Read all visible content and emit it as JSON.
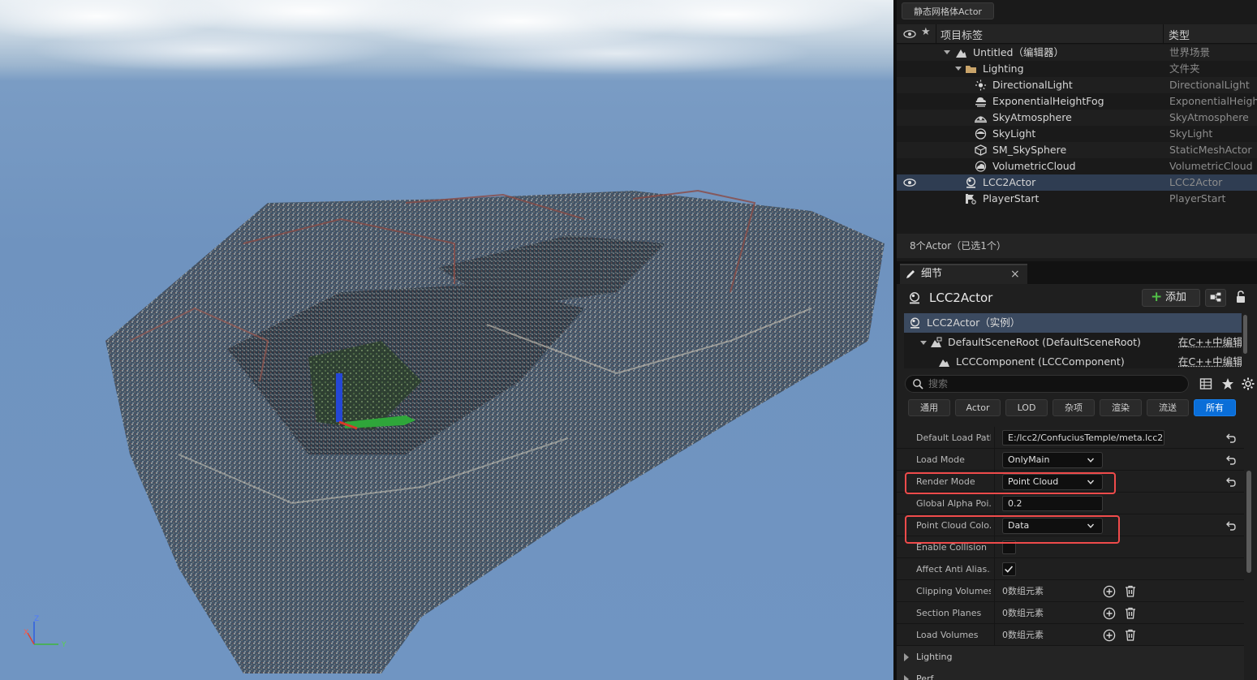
{
  "outliner": {
    "top_chip": "静态网格体Actor",
    "header": {
      "label_col": "项目标签",
      "type_col": "类型"
    },
    "rows": [
      {
        "name": "Untitled（编辑器）",
        "type": "世界场景",
        "icon": "world-icon"
      },
      {
        "name": "Lighting",
        "type": "文件夹",
        "icon": "folder-icon"
      },
      {
        "name": "DirectionalLight",
        "type": "DirectionalLight",
        "icon": "directional-light-icon"
      },
      {
        "name": "ExponentialHeightFog",
        "type": "ExponentialHeightF",
        "icon": "fog-icon"
      },
      {
        "name": "SkyAtmosphere",
        "type": "SkyAtmosphere",
        "icon": "sky-atmosphere-icon"
      },
      {
        "name": "SkyLight",
        "type": "SkyLight",
        "icon": "skylight-icon"
      },
      {
        "name": "SM_SkySphere",
        "type": "StaticMeshActor",
        "icon": "static-mesh-icon"
      },
      {
        "name": "VolumetricCloud",
        "type": "VolumetricCloud",
        "icon": "cloud-icon"
      },
      {
        "name": "LCC2Actor",
        "type": "LCC2Actor",
        "icon": "actor-icon",
        "selected": true
      },
      {
        "name": "PlayerStart",
        "type": "PlayerStart",
        "icon": "player-start-icon"
      }
    ],
    "status": "8个Actor（已选1个）"
  },
  "details": {
    "tab_label": "细节",
    "actor_name": "LCC2Actor",
    "add_label": "添加",
    "components": [
      {
        "name": "LCC2Actor（实例）"
      },
      {
        "name": "DefaultSceneRoot (DefaultSceneRoot)",
        "edit": "在C++中编辑"
      },
      {
        "name": "LCCComponent (LCCComponent)",
        "edit": "在C++中编辑"
      }
    ],
    "search_placeholder": "搜索",
    "filters": [
      "通用",
      "Actor",
      "LOD",
      "杂项",
      "渲染",
      "流送",
      "所有"
    ],
    "active_filter": "所有",
    "properties": {
      "default_load_path": {
        "label": "Default Load Path",
        "value": "E:/lcc2/ConfuciusTemple/meta.lcc2"
      },
      "load_mode": {
        "label": "Load Mode",
        "value": "OnlyMain"
      },
      "render_mode": {
        "label": "Render Mode",
        "value": "Point Cloud"
      },
      "global_alpha": {
        "label": "Global Alpha Poi...",
        "value": "0.2"
      },
      "point_cloud_color": {
        "label": "Point Cloud Colo...",
        "value": "Data"
      },
      "enable_collision": {
        "label": "Enable Collision",
        "checked": false
      },
      "affect_anti_alias": {
        "label": "Affect Anti Alias...",
        "checked": true
      },
      "clipping_volumes": {
        "label": "Clipping Volumes",
        "value": "0数组元素"
      },
      "section_planes": {
        "label": "Section Planes",
        "value": "0数组元素"
      },
      "load_volumes": {
        "label": "Load Volumes",
        "value": "0数组元素"
      }
    },
    "sections": [
      "Lighting",
      "Perf..."
    ]
  },
  "viewport": {
    "axis": {
      "x": "X",
      "y": "Y",
      "z": "Z"
    }
  },
  "colors": {
    "accent": "#0a6ed8",
    "highlight": "#ef4b4b",
    "selected_row": "#2f3d52"
  }
}
